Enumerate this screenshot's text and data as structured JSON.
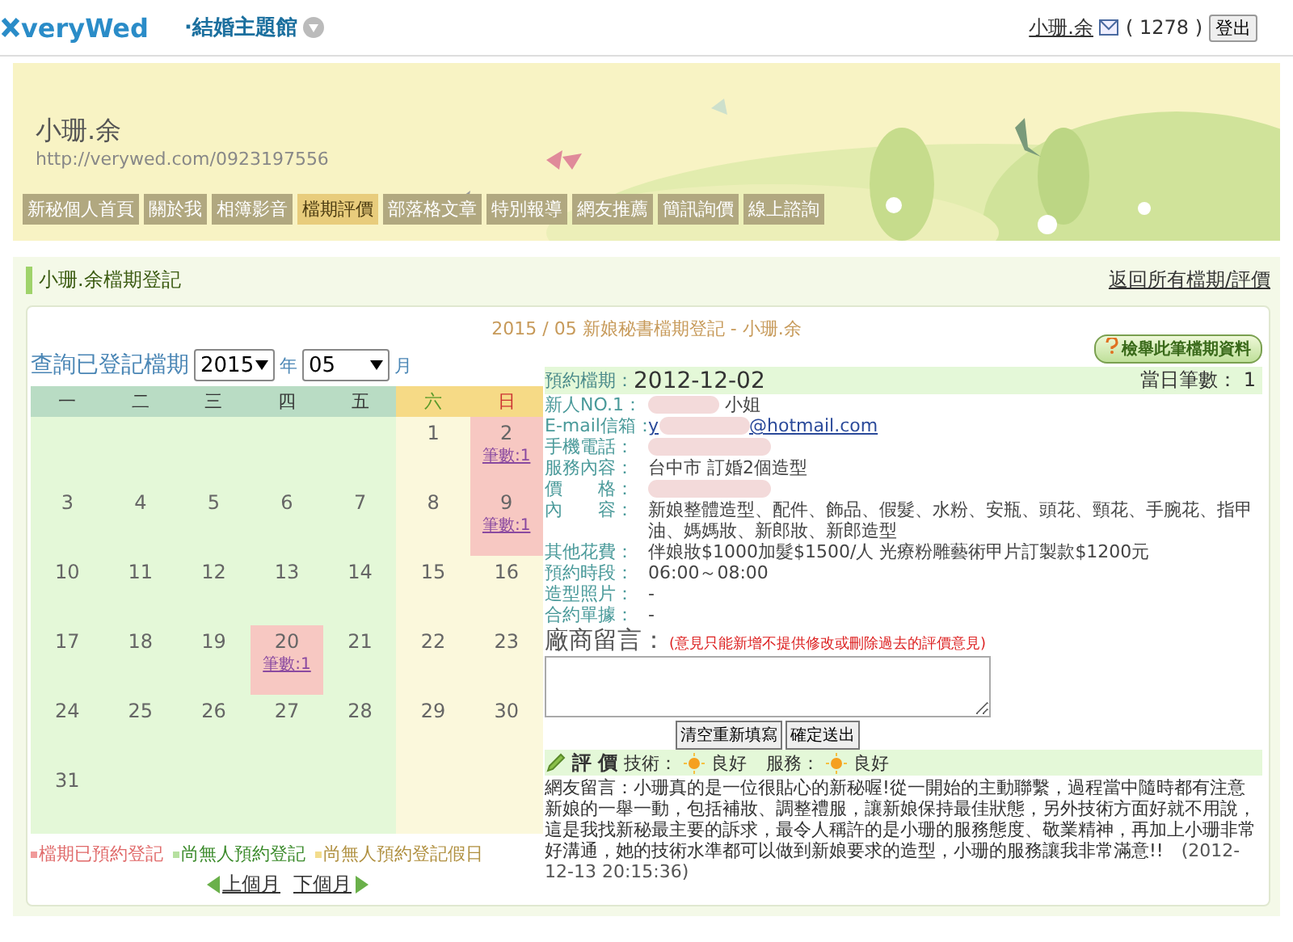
{
  "topbar": {
    "logo": "veryWed",
    "site_menu": "·結婚主題館",
    "user": "小珊.余",
    "count": "( 1278 )",
    "logout": "登出"
  },
  "profile": {
    "name": "小珊.余",
    "url": "http://verywed.com/0923197556"
  },
  "tabs": [
    {
      "label": "新秘個人首頁",
      "selected": false
    },
    {
      "label": "關於我",
      "selected": false
    },
    {
      "label": "相簿影音",
      "selected": false
    },
    {
      "label": "檔期評價",
      "selected": true
    },
    {
      "label": "部落格文章",
      "selected": false
    },
    {
      "label": "特別報導",
      "selected": false
    },
    {
      "label": "網友推薦",
      "selected": false
    },
    {
      "label": "簡訊詢價",
      "selected": false
    },
    {
      "label": "線上諮詢",
      "selected": false
    }
  ],
  "section": {
    "title": "小珊.余檔期登記",
    "back_link": "返回所有檔期/評價"
  },
  "panel_title": "2015 / 05 新娘秘書檔期登記 - 小珊.余",
  "query": {
    "label": "查詢已登記檔期",
    "year": "2015",
    "year_unit": "年",
    "month": "05",
    "month_unit": "月"
  },
  "calendar": {
    "weekdays": [
      "一",
      "二",
      "三",
      "四",
      "五",
      "六",
      "日"
    ],
    "weeks": [
      [
        {
          "kind": "empty"
        },
        {
          "kind": "empty"
        },
        {
          "kind": "empty"
        },
        {
          "kind": "empty"
        },
        {
          "kind": "empty"
        },
        {
          "kind": "day",
          "day": "1",
          "booked": false
        },
        {
          "kind": "day",
          "day": "2",
          "booked": true,
          "link": "筆數:1"
        }
      ],
      [
        {
          "kind": "day",
          "day": "3",
          "booked": false
        },
        {
          "kind": "day",
          "day": "4",
          "booked": false
        },
        {
          "kind": "day",
          "day": "5",
          "booked": false
        },
        {
          "kind": "day",
          "day": "6",
          "booked": false
        },
        {
          "kind": "day",
          "day": "7",
          "booked": false
        },
        {
          "kind": "day",
          "day": "8",
          "booked": false
        },
        {
          "kind": "day",
          "day": "9",
          "booked": true,
          "link": "筆數:1"
        }
      ],
      [
        {
          "kind": "day",
          "day": "10",
          "booked": false
        },
        {
          "kind": "day",
          "day": "11",
          "booked": false
        },
        {
          "kind": "day",
          "day": "12",
          "booked": false
        },
        {
          "kind": "day",
          "day": "13",
          "booked": false
        },
        {
          "kind": "day",
          "day": "14",
          "booked": false
        },
        {
          "kind": "day",
          "day": "15",
          "booked": false
        },
        {
          "kind": "day",
          "day": "16",
          "booked": false
        }
      ],
      [
        {
          "kind": "day",
          "day": "17",
          "booked": false
        },
        {
          "kind": "day",
          "day": "18",
          "booked": false
        },
        {
          "kind": "day",
          "day": "19",
          "booked": false
        },
        {
          "kind": "day",
          "day": "20",
          "booked": true,
          "link": "筆數:1"
        },
        {
          "kind": "day",
          "day": "21",
          "booked": false
        },
        {
          "kind": "day",
          "day": "22",
          "booked": false
        },
        {
          "kind": "day",
          "day": "23",
          "booked": false
        }
      ],
      [
        {
          "kind": "day",
          "day": "24",
          "booked": false
        },
        {
          "kind": "day",
          "day": "25",
          "booked": false
        },
        {
          "kind": "day",
          "day": "26",
          "booked": false
        },
        {
          "kind": "day",
          "day": "27",
          "booked": false
        },
        {
          "kind": "day",
          "day": "28",
          "booked": false
        },
        {
          "kind": "day",
          "day": "29",
          "booked": false
        },
        {
          "kind": "day",
          "day": "30",
          "booked": false
        }
      ],
      [
        {
          "kind": "day",
          "day": "31",
          "booked": false
        },
        {
          "kind": "empty"
        },
        {
          "kind": "empty"
        },
        {
          "kind": "empty"
        },
        {
          "kind": "empty"
        },
        {
          "kind": "empty"
        },
        {
          "kind": "empty"
        }
      ]
    ]
  },
  "legend": [
    {
      "label": "檔期已預約登記",
      "color": "#f09a9a"
    },
    {
      "label": "尚無人預約登記",
      "color": "#b6e0a0"
    },
    {
      "label": "尚無人預約登記假日",
      "color": "#f3dc8c"
    }
  ],
  "month_nav": {
    "prev": "上個月",
    "next": "下個月"
  },
  "report_button": "檢舉此筆檔期資料",
  "booking": {
    "date_label": "預約檔期：",
    "date": "2012-12-02",
    "count_label": "當日筆數：",
    "count": "1",
    "fields": [
      {
        "kind": "name",
        "label": "新人NO.1：",
        "value": "小姐"
      },
      {
        "kind": "email",
        "label": "E-mail信箱：",
        "value": "y",
        "value_end": "@hotmail.com"
      },
      {
        "kind": "redacted",
        "label": "手機電話："
      },
      {
        "kind": "text",
        "label": "服務內容：",
        "value": "台中市 訂婚2個造型"
      },
      {
        "kind": "redacted",
        "label": "價　　格："
      },
      {
        "kind": "text",
        "label": "內　　容：",
        "value": "新娘整體造型、配件、飾品、假髮、水粉、安瓶、頭花、頸花、手腕花、指甲油、媽媽妝、新郎妝、新郎造型"
      },
      {
        "kind": "text",
        "label": "其他花費：",
        "value": "伴娘妝$1000加髮$1500/人 光療粉雕藝術甲片訂製款$1200元"
      },
      {
        "kind": "text",
        "label": "預約時段：",
        "value": "06:00～08:00"
      },
      {
        "kind": "text",
        "label": "造型照片：",
        "value": "-"
      },
      {
        "kind": "text",
        "label": "合約單據：",
        "value": "-"
      }
    ]
  },
  "vendor_message": {
    "label": "廠商留言：",
    "note": "(意見只能新增不提供修改或刪除過去的評價意見)",
    "clear_button": "清空重新填寫",
    "submit_button": "確定送出"
  },
  "rating": {
    "title": "評 價",
    "skill_label": "技術：",
    "skill": "良好",
    "service_label": "服務：",
    "service": "良好"
  },
  "comment": {
    "text": "網友留言：小珊真的是一位很貼心的新秘喔!從一開始的主動聯繫，過程當中隨時都有注意新娘的一舉一動，包括補妝、調整禮服，讓新娘保持最佳狀態，另外技術方面好就不用說，這是我找新秘最主要的訴求，最令人稱許的是小珊的服務態度、敬業精神，再加上小珊非常好溝通，她的技術水準都可以做到新娘要求的造型，小珊的服務讓我非常滿意!!",
    "date": "(2012-12-13 20:15:36)"
  }
}
